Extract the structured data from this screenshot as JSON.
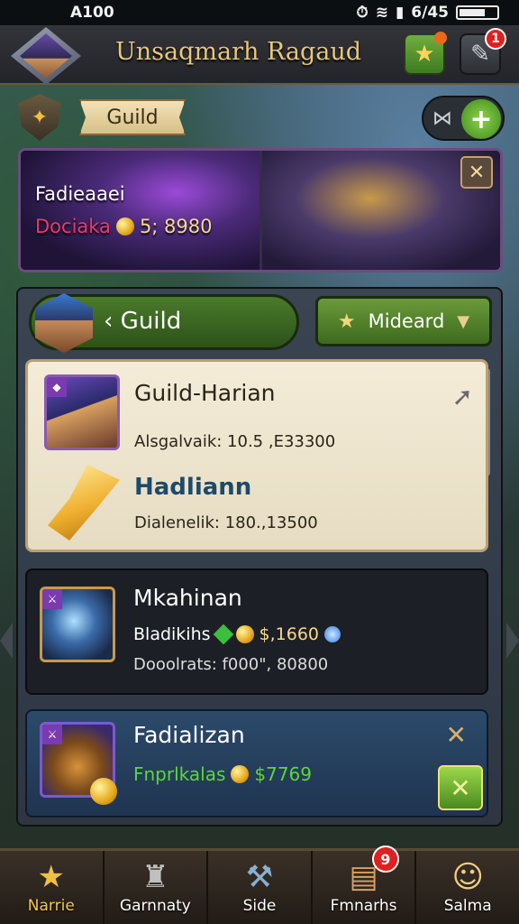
{
  "status_bar": {
    "time": "A100",
    "battery_text": "6/45"
  },
  "header": {
    "title": "Unsaqmarh Ragaud",
    "settings_badge": "1"
  },
  "guild_tab": {
    "label": "Guild"
  },
  "hero_panel": {
    "name": "Fadieaaei",
    "stat_label": "Dociaka",
    "stat_value": "5; 8980"
  },
  "list_header": {
    "guild_label": "Guild",
    "sort_label": "Mideard"
  },
  "cards": [
    {
      "title": "Guild-Harian",
      "line_a": "Alsgalvaik: 10.5 ,E33300",
      "subtitle": "Hadliann",
      "line_b": "Dialenelik: 180.,13500"
    },
    {
      "title": "Mkahinan",
      "line_a_label": "Bladikihs",
      "line_a_value": "$,1660",
      "line_b": "Dooolrats: f000\", 80800"
    },
    {
      "title": "Fadializan",
      "line_a_label": "Fnprlkalas",
      "line_a_value": "$7769"
    }
  ],
  "bottom_nav": [
    {
      "label": "Narrie",
      "icon": "star-chest-icon"
    },
    {
      "label": "Garnnaty",
      "icon": "helmet-icon"
    },
    {
      "label": "Side",
      "icon": "anvil-icon"
    },
    {
      "label": "Fmnarhs",
      "icon": "treasure-chest-icon",
      "badge": "9"
    },
    {
      "label": "Salma",
      "icon": "coin-face-icon"
    }
  ]
}
